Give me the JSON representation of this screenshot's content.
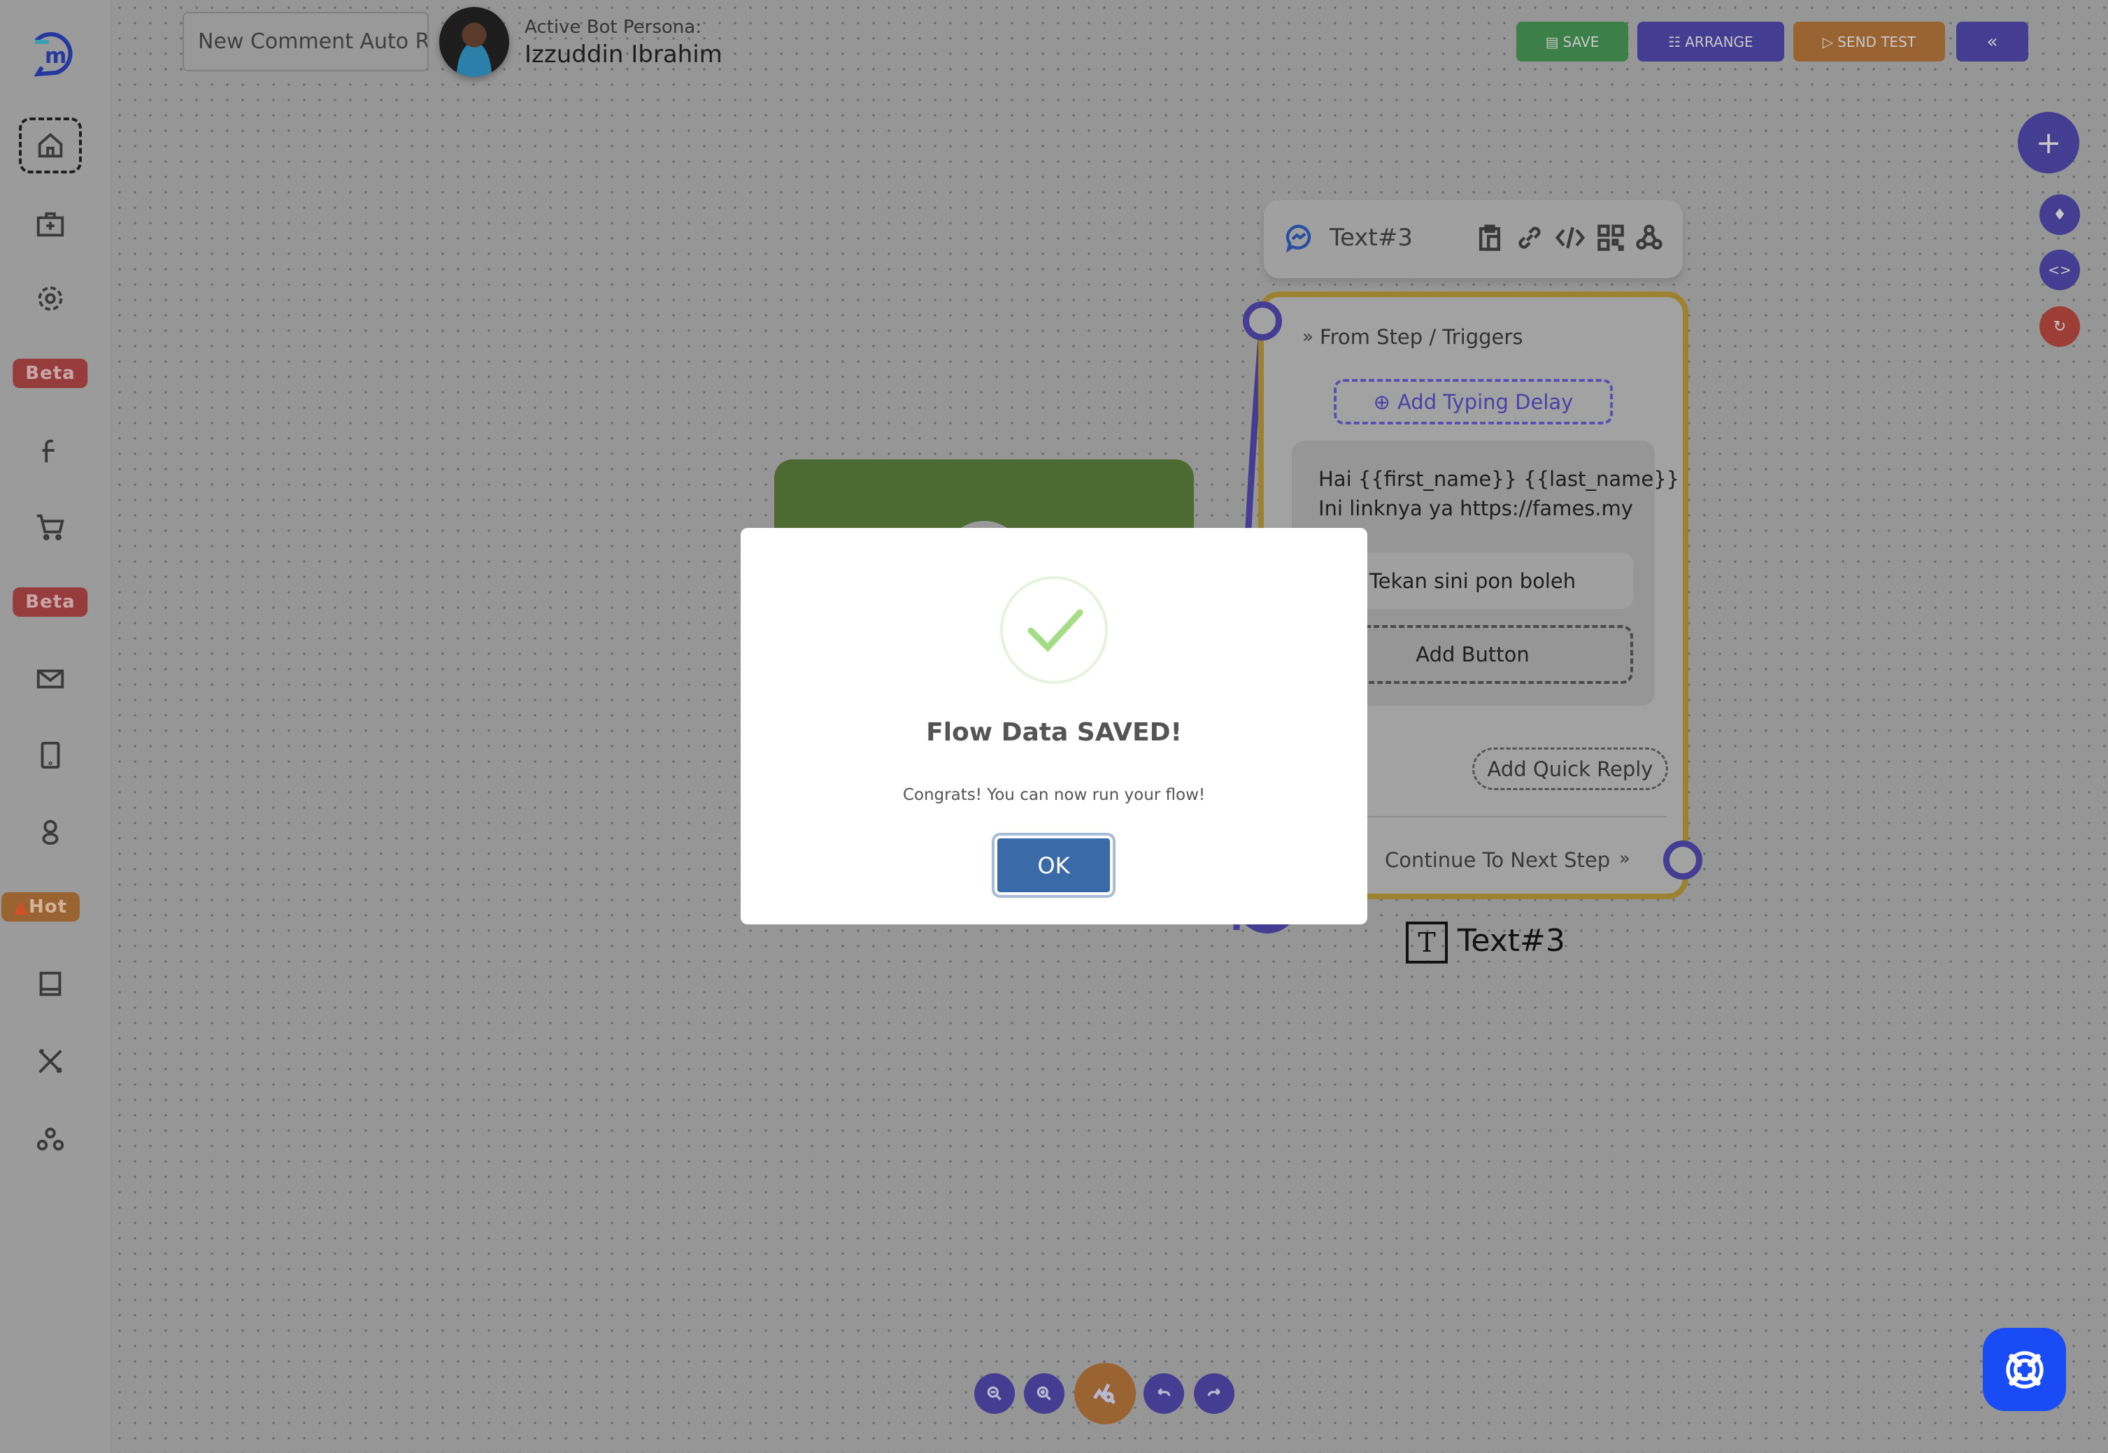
{
  "header": {
    "flow_title": "New Comment Auto R",
    "persona_label": "Active Bot Persona:",
    "persona_name": "Izzuddin Ibrahim"
  },
  "toolbar": {
    "save": "SAVE",
    "arrange": "ARRANGE",
    "send_test": "SEND TEST",
    "collapse": "«"
  },
  "sidebar": {
    "items": [
      {
        "icon": "home-icon"
      },
      {
        "icon": "medkit-icon"
      },
      {
        "icon": "gear-icon"
      },
      {
        "badge": "Beta"
      },
      {
        "icon": "facebook-icon"
      },
      {
        "icon": "cart-icon"
      },
      {
        "badge": "Beta"
      },
      {
        "icon": "mail-icon"
      },
      {
        "icon": "tablet-icon"
      },
      {
        "icon": "google-icon"
      },
      {
        "badge": "Hot"
      },
      {
        "icon": "book-icon"
      },
      {
        "icon": "tools-icon"
      },
      {
        "icon": "nodes-icon"
      }
    ]
  },
  "node": {
    "header_title": "Text#3",
    "from_step": "From Step / Triggers",
    "add_typing_delay": "Add Typing Delay",
    "message_lines": [
      "Hai {{first_name}} {{last_name}}",
      "Ini linknya ya https://fames.my"
    ],
    "button_label": "Tekan sini pon boleh",
    "add_button": "Add Button",
    "add_quick_reply": "Add Quick Reply",
    "continue": "Continue To Next Step",
    "caption": "Text#3"
  },
  "modal": {
    "title": "Flow Data SAVED!",
    "message": "Congrats! You can now run your flow!",
    "ok": "OK"
  },
  "colors": {
    "save": "#3d7f48",
    "arrange": "#443d91",
    "send_test": "#9a6432",
    "node_border": "#9c8230",
    "green_node": "#4c6b33",
    "help": "#1a4cf5",
    "check": "#a5dc86"
  }
}
